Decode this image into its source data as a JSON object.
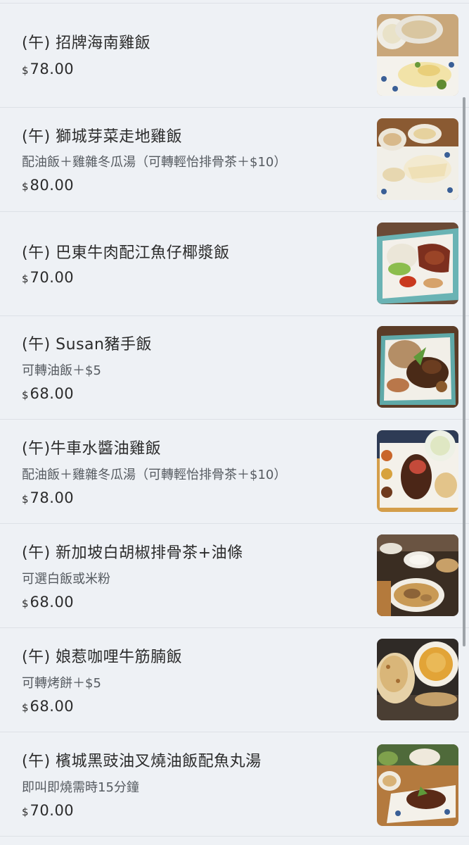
{
  "currency_symbol": "$",
  "items": [
    {
      "name": "(午) 招牌海南雞飯",
      "desc": "",
      "price": "78.00",
      "image": "hainan-chicken-rice-photo"
    },
    {
      "name": "(午) 獅城芽菜走地雞飯",
      "desc": "配油飯＋雞雜冬瓜湯（可轉輕怡排骨茶＋$10）",
      "price": "80.00",
      "image": "beansprout-chicken-rice-photo"
    },
    {
      "name": "(午) 巴東牛肉配江魚仔椰漿飯",
      "desc": "",
      "price": "70.00",
      "image": "beef-rendang-nasi-lemak-photo"
    },
    {
      "name": "(午) Susan豬手飯",
      "desc": "可轉油飯＋$5",
      "price": "68.00",
      "image": "pork-knuckle-rice-photo"
    },
    {
      "name": "(午)牛車水醬油雞飯",
      "desc": "配油飯＋雞雜冬瓜湯（可轉輕怡排骨茶＋$10）",
      "price": "78.00",
      "image": "soy-sauce-chicken-rice-photo"
    },
    {
      "name": "(午) 新加坡白胡椒排骨茶+油條",
      "desc": "可選白飯或米粉",
      "price": "68.00",
      "image": "bak-kut-teh-photo"
    },
    {
      "name": "(午) 娘惹咖哩牛筋腩飯",
      "desc": "可轉烤餅＋$5",
      "price": "68.00",
      "image": "nyonya-curry-beef-photo"
    },
    {
      "name": "(午) 檳城黑豉油叉燒油飯配魚丸湯",
      "desc": "即叫即燒需時15分鐘",
      "price": "70.00",
      "image": "char-siu-rice-photo"
    }
  ]
}
